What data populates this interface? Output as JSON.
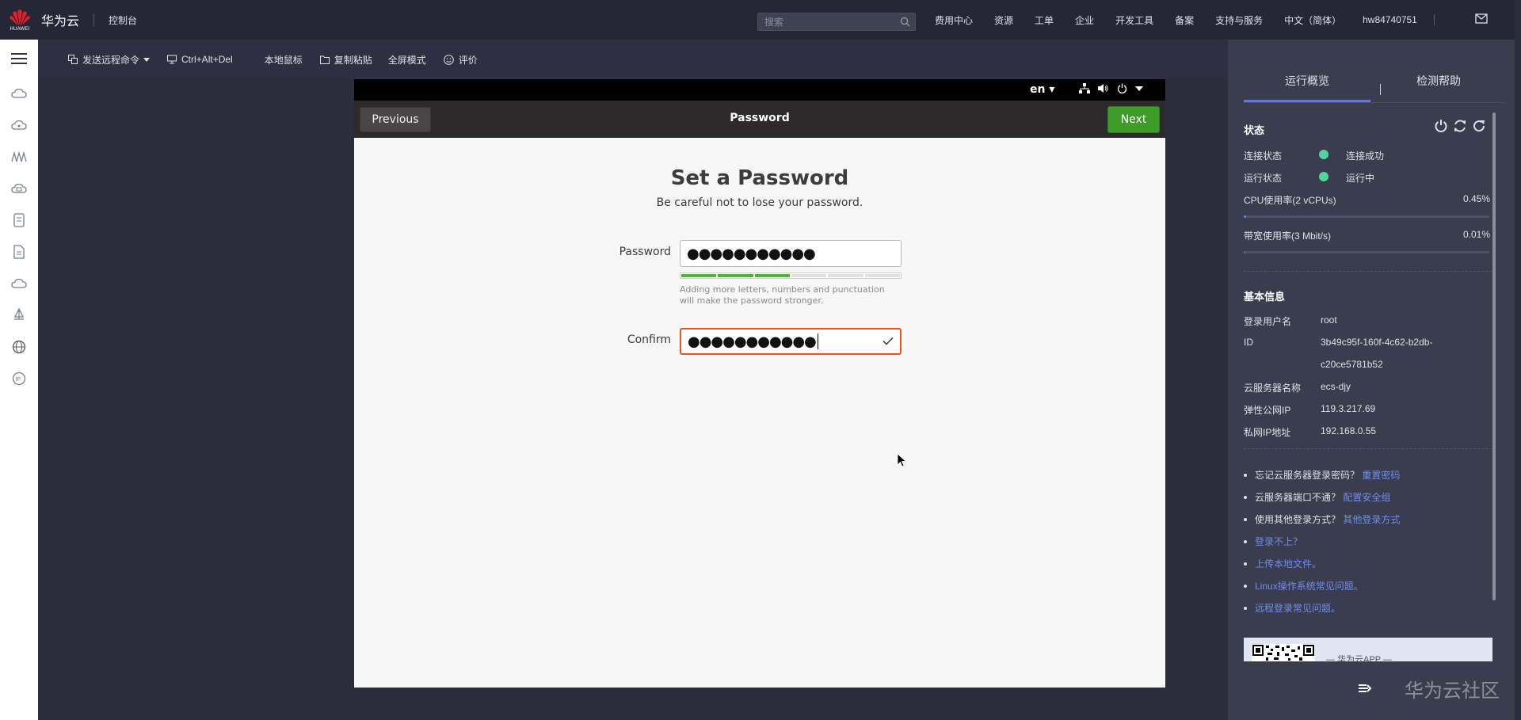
{
  "topbar": {
    "brand_small": "HUAWEI",
    "site_name": "华为云",
    "console": "控制台",
    "search_placeholder": "搜索",
    "nav": [
      "费用中心",
      "资源",
      "工单",
      "企业",
      "开发工具",
      "备案",
      "支持与服务",
      "中文（简体）"
    ],
    "username": "hw84740751",
    "icons": [
      "search-icon",
      "mail-icon"
    ]
  },
  "rail": {
    "icons": [
      "menu-icon",
      "cloud-icon",
      "network-icon",
      "bridge-icon",
      "storage-cloud-icon",
      "server-icon",
      "document-icon",
      "cloud-outline-icon",
      "deploy-icon",
      "globe-icon",
      "ip-icon"
    ]
  },
  "toolbar": {
    "send_command": "发送远程命令",
    "ctrl_alt_del": "Ctrl+Alt+Del",
    "local_mouse": "本地鼠标",
    "copy_paste": "复制粘贴",
    "fullscreen": "全屏模式",
    "rate": "评价"
  },
  "vm": {
    "lang": "en",
    "previous": "Previous",
    "title": "Password",
    "next": "Next",
    "heading": "Set a Password",
    "subheading": "Be careful not to lose your password.",
    "password_label": "Password",
    "password_value": "●●●●●●●●●●●",
    "strength_segments": 6,
    "strength_filled": 3,
    "hint": "Adding more letters, numbers and punctuation will make the password stronger.",
    "confirm_label": "Confirm",
    "confirm_value": "●●●●●●●●●●●"
  },
  "panel": {
    "tabs": [
      "运行概览",
      "检测帮助"
    ],
    "active_tab": 0,
    "status": {
      "title": "状态",
      "connection_label": "连接状态",
      "connection_value": "连接成功",
      "running_label": "运行状态",
      "running_value": "运行中",
      "cpu_label": "CPU使用率(2 vCPUs)",
      "cpu_value": "0.45%",
      "cpu_fraction": 0.0045,
      "bandwidth_label": "带宽使用率(3 Mbit/s)",
      "bandwidth_value": "0.01%",
      "bandwidth_fraction": 0.0001,
      "status_color": "#50d4a0"
    },
    "basic": {
      "title": "基本信息",
      "user_label": "登录用户名",
      "user_value": "root",
      "id_label": "ID",
      "id_value_1": "3b49c95f-160f-4c62-b2db-",
      "id_value_2": "c20ce5781b52",
      "name_label": "云服务器名称",
      "name_value": "ecs-djy",
      "eip_label": "弹性公网IP",
      "eip_value": "119.3.217.69",
      "pip_label": "私网IP地址",
      "pip_value": "192.168.0.55"
    },
    "help": [
      {
        "text": "忘记云服务器登录密码？",
        "link": "重置密码"
      },
      {
        "text": "云服务器端口不通？",
        "link": "配置安全组"
      },
      {
        "text": "使用其他登录方式？",
        "link": "其他登录方式"
      },
      {
        "text": "",
        "link": "登录不上？"
      },
      {
        "text": "",
        "link": "上传本地文件。"
      },
      {
        "text": "",
        "link": "Linux操作系统常见问题。"
      },
      {
        "text": "",
        "link": "远程登录常见问题。"
      }
    ],
    "banner_text": "— 华为云APP —",
    "accent_color": "#5e7ce0",
    "link_color": "#6f8cf0"
  },
  "watermark": "华为云社区"
}
